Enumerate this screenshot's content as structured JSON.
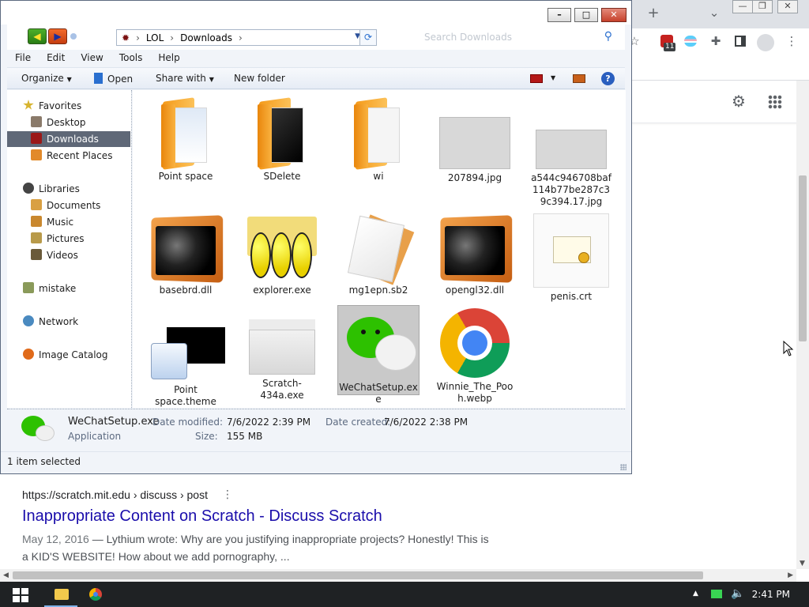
{
  "browser": {
    "new_tab_glyph": "+",
    "dropdown_glyph": "⌄",
    "window_controls": [
      "—",
      "❐",
      "✕"
    ],
    "toolbar_icons": [
      "star-icon",
      "extension-badge-icon",
      "extension-icon",
      "puzzle-icon",
      "sidebar-icon",
      "profile-icon",
      "more-icon"
    ],
    "extension_badge": "11",
    "header_icons": [
      "settings-gear-icon",
      "apps-grid-icon"
    ],
    "result": {
      "url": "https://scratch.mit.edu › discuss › post",
      "title": "Inappropriate Content on Scratch - Discuss Scratch",
      "date": "May 12, 2016",
      "snippet_part1": " — Lythium wrote: Why are you justifying inappropriate projects? Honestly! This is",
      "snippet_part2": "a KID'S WEBSITE! How about we add pornography, ..."
    }
  },
  "explorer": {
    "breadcrumb": [
      "LOL",
      "Downloads"
    ],
    "search_placeholder": "Search Downloads",
    "menu": [
      "File",
      "Edit",
      "View",
      "Tools",
      "Help"
    ],
    "commands": {
      "organize": "Organize",
      "open": "Open",
      "share_with": "Share with",
      "new_folder": "New folder"
    },
    "nav": {
      "favorites": "Favorites",
      "desktop": "Desktop",
      "downloads": "Downloads",
      "recent_places": "Recent Places",
      "libraries": "Libraries",
      "documents": "Documents",
      "music": "Music",
      "pictures": "Pictures",
      "videos": "Videos",
      "mistake": "mistake",
      "network": "Network",
      "image_catalog": "Image Catalog"
    },
    "files": [
      {
        "name": "Point space",
        "kind": "folder"
      },
      {
        "name": "SDelete",
        "kind": "folder"
      },
      {
        "name": "wi",
        "kind": "folder"
      },
      {
        "name": "207894.jpg",
        "kind": "photo"
      },
      {
        "name": "a544c946708baf114b77be287c39c394.17.jpg",
        "kind": "photo"
      },
      {
        "name": "basebrd.dll",
        "kind": "dll"
      },
      {
        "name": "explorer.exe",
        "kind": "exe"
      },
      {
        "name": "mg1epn.sb2",
        "kind": "file"
      },
      {
        "name": "opengl32.dll",
        "kind": "dll"
      },
      {
        "name": "penis.crt",
        "kind": "certificate"
      },
      {
        "name": "Point space.theme",
        "kind": "theme"
      },
      {
        "name": "Scratch-434a.exe",
        "kind": "installer"
      },
      {
        "name": "WeChatSetup.exe",
        "kind": "wechat",
        "selected": true
      },
      {
        "name": "Winnie_The_Pooh.webp",
        "kind": "chrome"
      }
    ],
    "details": {
      "name": "WeChatSetup.exe",
      "type": "Application",
      "date_modified_label": "Date modified:",
      "date_modified": "7/6/2022 2:39 PM",
      "size_label": "Size:",
      "size": "155 MB",
      "date_created_label": "Date created:",
      "date_created": "7/6/2022 2:38 PM"
    },
    "status": "1 item selected"
  },
  "taskbar": {
    "time": "2:41 PM",
    "apps": [
      "file-explorer-icon",
      "chrome-icon"
    ]
  },
  "colors": {
    "selection": "#5f6877",
    "link": "#1a0dab",
    "wechat": "#2dc100",
    "taskbar": "#1f2224"
  }
}
